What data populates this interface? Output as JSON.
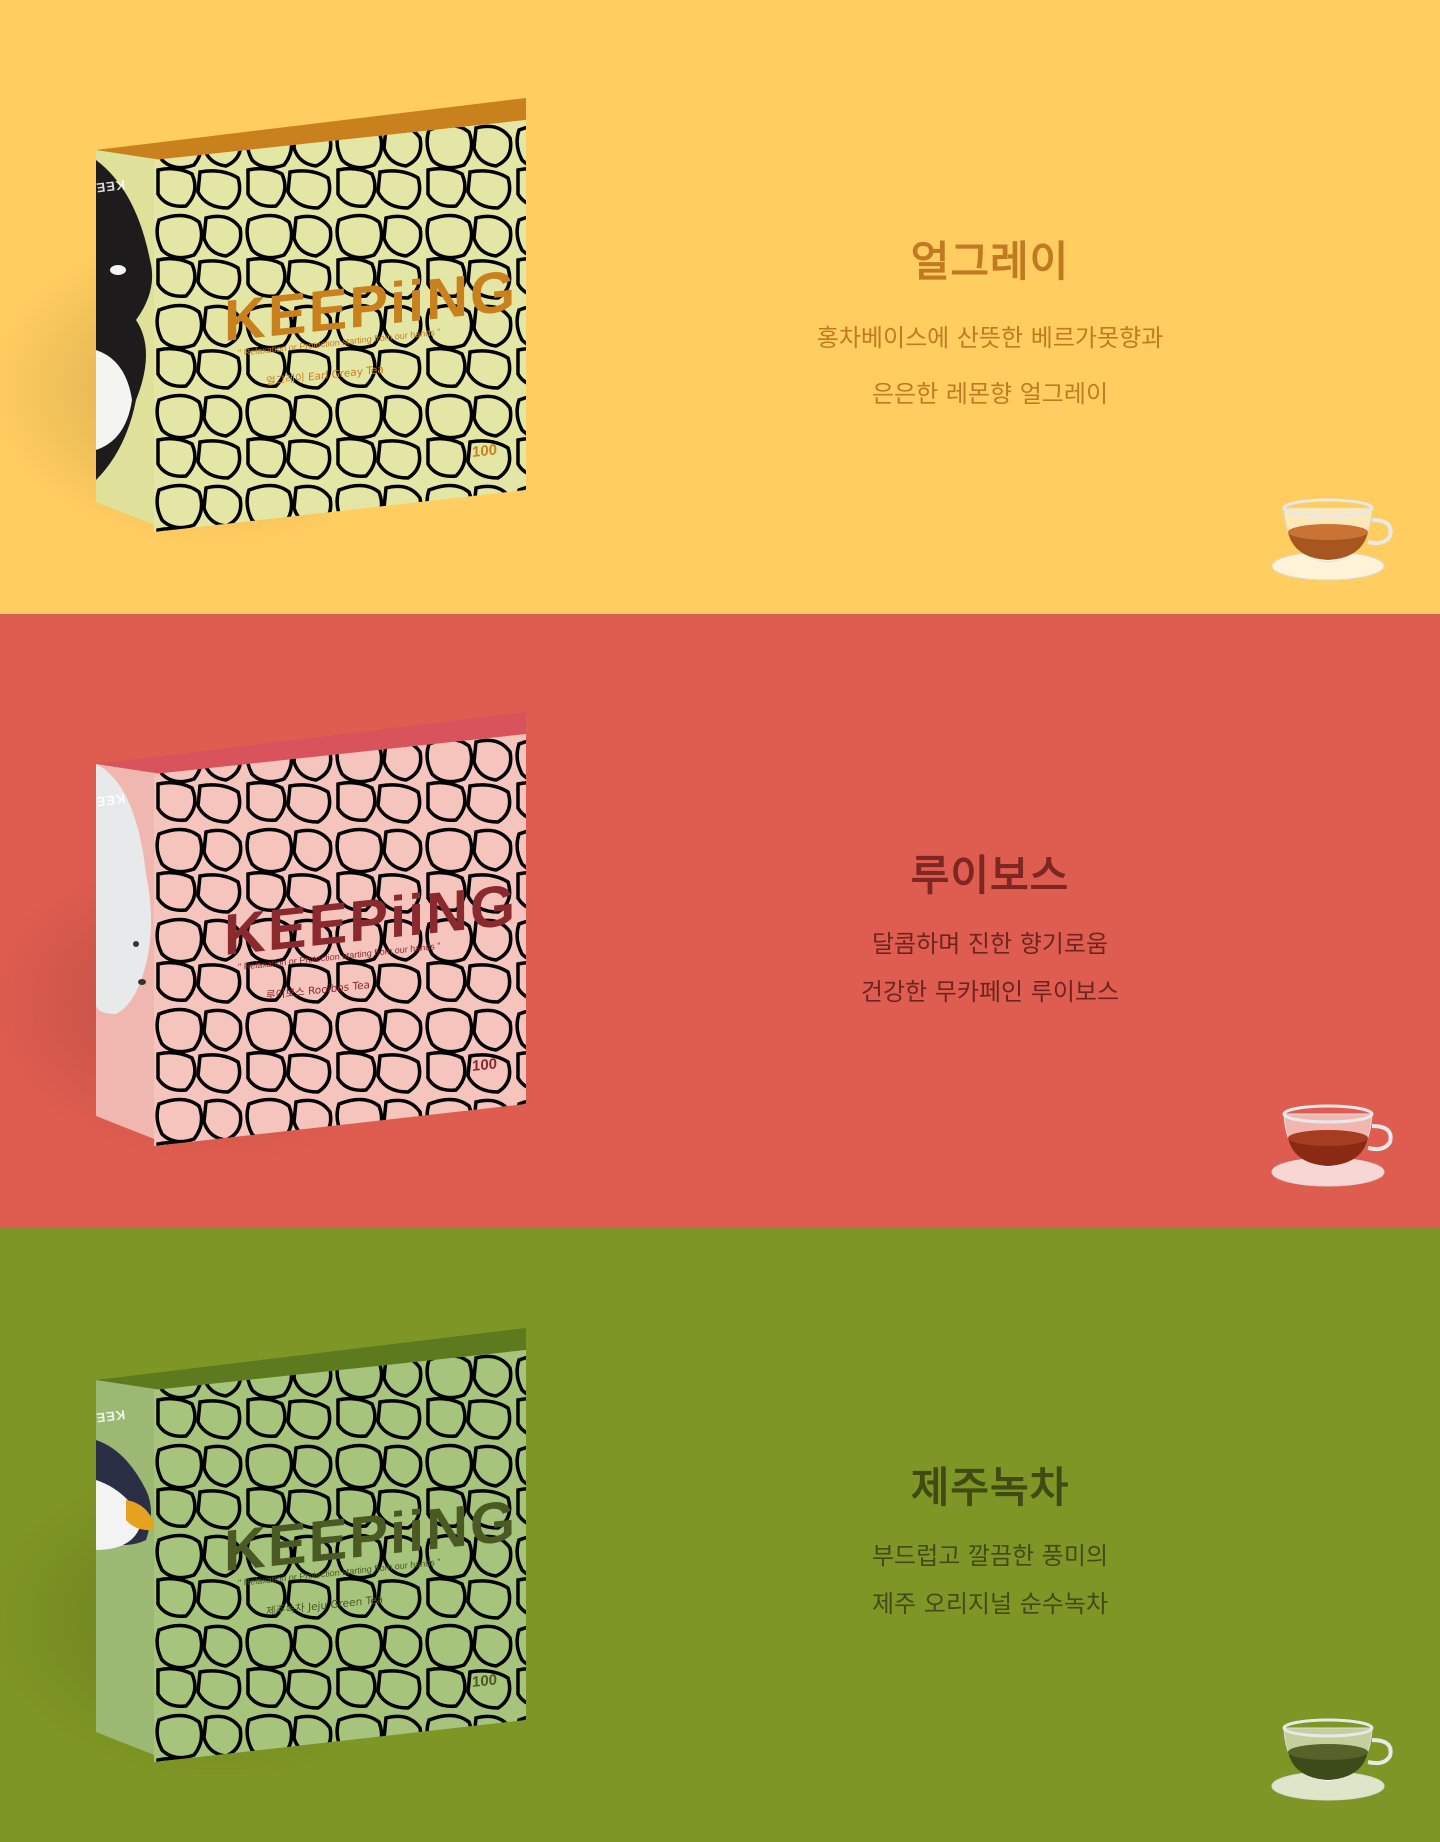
{
  "brand": "KEEPiiNG",
  "tagline": "\" Relaxation or Protection starting from our hands \"",
  "sections": [
    {
      "title": "얼그레이",
      "desc_line1": "홍차베이스에 산뜻한 베르가못향과",
      "desc_line2": "은은한 레몬향 얼그레이",
      "product_label": "얼그레이 Earl Greay Tea",
      "count": "100",
      "animal": "orca-icon",
      "colors": {
        "bg": "#ffcd60",
        "box": "#e4e6a6",
        "top": "#c8811d",
        "pattern": "#d8d566",
        "text": "#c27a22",
        "tea": "#a8561f"
      }
    },
    {
      "title": "루이보스",
      "desc_line1": "달콤하며 진한 향기로움",
      "desc_line2": "건강한 무카페인 루이보스",
      "product_label": "루이보스 Rooibos Tea",
      "count": "100",
      "animal": "polar-bear-icon",
      "colors": {
        "bg": "#df5d50",
        "box": "#f5c4bc",
        "top": "#d8535b",
        "pattern": "#e8a39b",
        "text": "#7d2622",
        "tea": "#8a2a15"
      }
    },
    {
      "title": "제주녹차",
      "desc_line1": "부드럽고 깔끔한 풍미의",
      "desc_line2": "제주 오리지널 순수녹차",
      "product_label": "제주녹차 Jeju Green Tea",
      "count": "100",
      "animal": "penguin-icon",
      "colors": {
        "bg": "#7e9625",
        "box": "#a7c47d",
        "top": "#5e7a1f",
        "pattern": "#8fae66",
        "text": "#3f4b12",
        "tea": "#3d4a1a"
      }
    }
  ]
}
